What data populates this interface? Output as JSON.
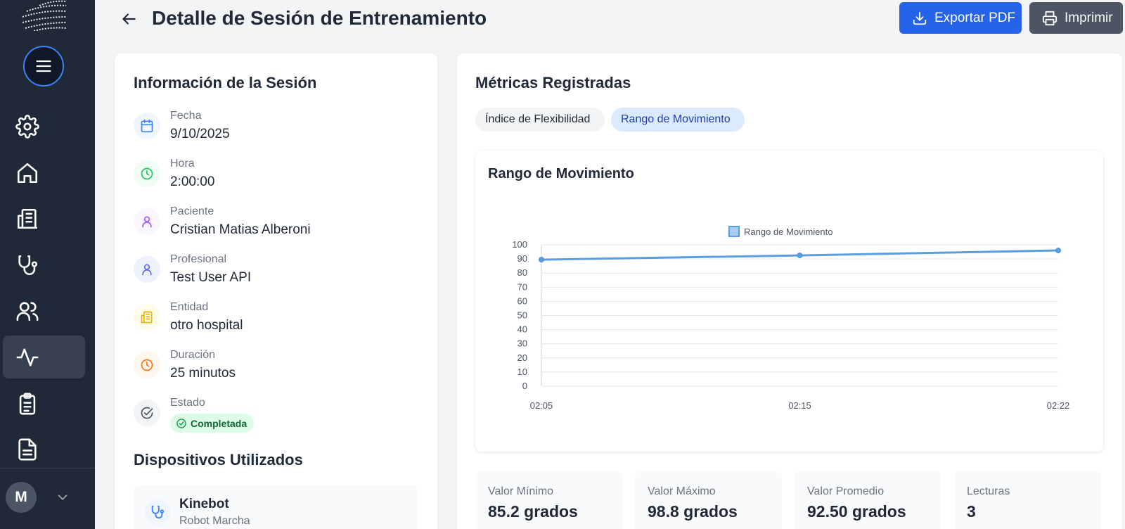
{
  "header": {
    "title": "Detalle de Sesión de Entrenamiento",
    "export_label": "Exportar PDF",
    "print_label": "Imprimir"
  },
  "sidebar": {
    "items": [
      {
        "name": "settings",
        "icon": "gear-icon"
      },
      {
        "name": "home",
        "icon": "home-icon"
      },
      {
        "name": "buildings",
        "icon": "building-icon"
      },
      {
        "name": "medical",
        "icon": "stethoscope-icon"
      },
      {
        "name": "users",
        "icon": "users-icon"
      },
      {
        "name": "activity",
        "icon": "activity-icon",
        "active": true
      },
      {
        "name": "tasks",
        "icon": "clipboard-icon"
      },
      {
        "name": "documents",
        "icon": "document-icon"
      }
    ],
    "user_initial": "M"
  },
  "session_info": {
    "title": "Información de la Sesión",
    "fields": [
      {
        "label": "Fecha",
        "value": "9/10/2025",
        "icon": "calendar-icon",
        "color": "#3b82f6"
      },
      {
        "label": "Hora",
        "value": "2:00:00",
        "icon": "clock-icon",
        "color": "#22c55e"
      },
      {
        "label": "Paciente",
        "value": "Cristian Matias Alberoni",
        "icon": "user-icon",
        "color": "#a855f7"
      },
      {
        "label": "Profesional",
        "value": "Test User API",
        "icon": "user-icon",
        "color": "#6366f1"
      },
      {
        "label": "Entidad",
        "value": "otro hospital",
        "icon": "building-icon",
        "color": "#eab308"
      },
      {
        "label": "Duración",
        "value": "25 minutos",
        "icon": "clock-icon",
        "color": "#f97316"
      },
      {
        "label": "Estado",
        "value": "Completada",
        "icon": "check-circle-icon",
        "color": "#4b5563"
      }
    ]
  },
  "devices": {
    "title": "Dispositivos Utilizados",
    "items": [
      {
        "name": "Kinebot",
        "type": "Robot Marcha",
        "icon": "stethoscope-icon"
      }
    ]
  },
  "metrics": {
    "title": "Métricas Registradas",
    "tabs": [
      {
        "label": "Índice de Flexibilidad",
        "active": false
      },
      {
        "label": "Rango de Movimiento",
        "active": true
      }
    ],
    "stats": [
      {
        "label": "Valor Mínimo",
        "value": "85.2 grados"
      },
      {
        "label": "Valor Máximo",
        "value": "98.8 grados"
      },
      {
        "label": "Valor Promedio",
        "value": "92.50 grados"
      },
      {
        "label": "Lecturas",
        "value": "3"
      }
    ]
  },
  "chart_data": {
    "type": "line",
    "title": "Rango de Movimiento",
    "x": [
      "02:05",
      "02:15",
      "02:22"
    ],
    "series": [
      {
        "name": "Rango de Movimiento",
        "values": [
          89.5,
          92.5,
          96
        ],
        "color": "#5b9ee0"
      }
    ],
    "ylim": [
      0,
      100
    ],
    "yticks": [
      0,
      10,
      20,
      30,
      40,
      50,
      60,
      70,
      80,
      90,
      100
    ],
    "legend": "top-center",
    "grid": true
  },
  "colors": {
    "sidebar_bg": "#1f2937",
    "accent": "#2563eb",
    "print_button": "#4b5563",
    "success_bg": "#dcfce7",
    "success_text": "#166534"
  }
}
